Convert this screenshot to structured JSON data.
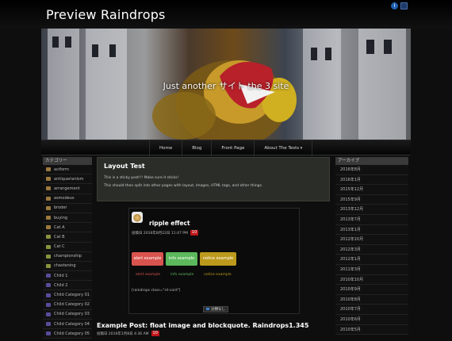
{
  "site": {
    "title": "Preview Raindrops",
    "tagline": "Just another サイト the 3 site"
  },
  "corner_icons": [
    "info-icon",
    "rss-icon"
  ],
  "nav": {
    "items": [
      {
        "label": "Home"
      },
      {
        "label": "Blog"
      },
      {
        "label": "Front Page"
      },
      {
        "label": "About The Tests"
      }
    ]
  },
  "left_sidebar": {
    "title": "カテゴリー",
    "items": [
      {
        "label": "aciform",
        "color": "#9b7a3e"
      },
      {
        "label": "antiquarianism",
        "color": "#9b7a3e"
      },
      {
        "label": "arrangement",
        "color": "#9b7a3e"
      },
      {
        "label": "asmodeus",
        "color": "#9b7a3e"
      },
      {
        "label": "broder",
        "color": "#9b7a3e"
      },
      {
        "label": "buying",
        "color": "#9b7a3e"
      },
      {
        "label": "Cat A",
        "color": "#9b7a3e"
      },
      {
        "label": "Cat B",
        "color": "#8a9240"
      },
      {
        "label": "Cat C",
        "color": "#8a9240"
      },
      {
        "label": "championship",
        "color": "#8a9240"
      },
      {
        "label": "chastening",
        "color": "#8a9240"
      },
      {
        "label": "Child 1",
        "color": "#5b4a9a"
      },
      {
        "label": "Child 2",
        "color": "#5b4a9a"
      },
      {
        "label": "Child Category 01",
        "color": "#5b4a9a"
      },
      {
        "label": "Child Category 02",
        "color": "#5b4a9a"
      },
      {
        "label": "Child Category 03",
        "color": "#5b4a9a"
      },
      {
        "label": "Child Category 04",
        "color": "#5b4a9a"
      },
      {
        "label": "Child Category 05",
        "color": "#5b4a9a"
      }
    ]
  },
  "right_sidebar": {
    "title": "アーカイブ",
    "items": [
      {
        "label": "2016年8月"
      },
      {
        "label": "2016年1月"
      },
      {
        "label": "2015年12月"
      },
      {
        "label": "2015年9月"
      },
      {
        "label": "2013年12月"
      },
      {
        "label": "2013年7月"
      },
      {
        "label": "2013年1月"
      },
      {
        "label": "2012年10月"
      },
      {
        "label": "2012年3月"
      },
      {
        "label": "2012年1月"
      },
      {
        "label": "2011年3月"
      },
      {
        "label": "2010年10月"
      },
      {
        "label": "2010年9月"
      },
      {
        "label": "2010年8月"
      },
      {
        "label": "2010年7月"
      },
      {
        "label": "2010年6月"
      },
      {
        "label": "2010年5月"
      }
    ]
  },
  "sticky": {
    "title": "Layout Test",
    "line1": "This is a sticky post!!! Make sure it sticks!",
    "line2": "This should then split into other pages with layout, images, HTML tags, and other things."
  },
  "post": {
    "title": "ripple effect",
    "meta": "投稿日 2016年8月22日 11:47 PM",
    "badge": "10",
    "buttons": {
      "alert": "alert example",
      "info": "info example",
      "notice": "notice example"
    },
    "links": {
      "alert": "alert example",
      "info": "info example",
      "notice": "notice example"
    },
    "shortcode": "[raindrops class=\"rd-card\"]",
    "share": "分類なし"
  },
  "post2": {
    "title": "Example Post: float image and blockquote. Raindrops1.345",
    "meta": "投稿日 2016年1月8日 4:36 AM",
    "badge": "10"
  }
}
